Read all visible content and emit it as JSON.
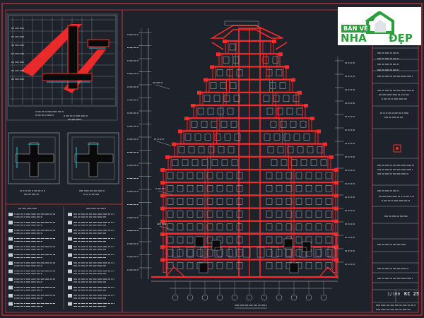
{
  "drawing": {
    "background": "#1e222a",
    "frame_color": "#d8323a",
    "line_color": "#c9ced6",
    "hatch_color": "#ff2a2a",
    "fill_color": "#0a0a0a",
    "accent_cyan": "#23c6d6"
  },
  "logo": {
    "line1": "BẢN VẼ",
    "line2": "NHÀ",
    "line3": "ĐẸP",
    "brand_color": "#2c9e3c"
  },
  "title_block": {
    "scale_text": "1/100",
    "sheet_no": "KC 25"
  }
}
